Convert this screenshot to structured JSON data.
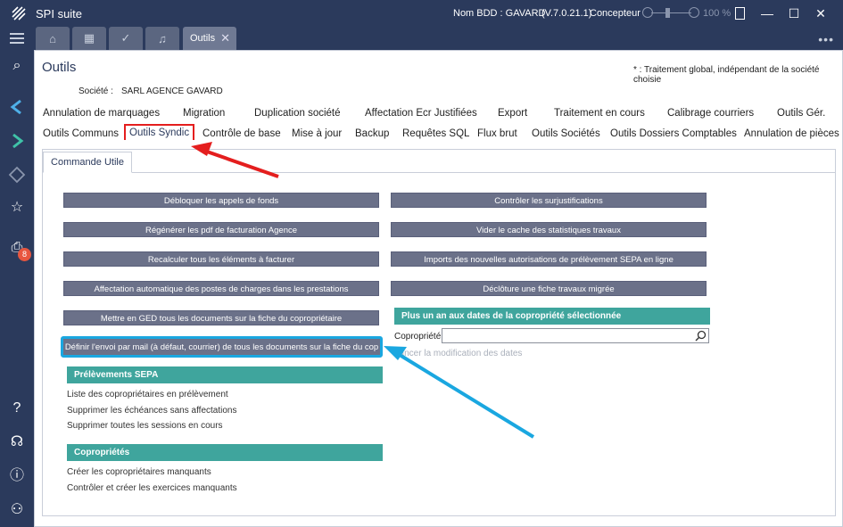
{
  "titlebar": {
    "app_title": "SPI suite",
    "db_label": "Nom BDD : GAVARD",
    "version": "(V.7.0.21.1)",
    "role": "Concepteur",
    "zoom": "100 %"
  },
  "tabs": {
    "active_label": "Outils"
  },
  "sidebar": {
    "badge_count": "8"
  },
  "page": {
    "title": "Outils",
    "note": "* : Traitement global, indépendant de la société choisie",
    "societe_label": "Société :",
    "societe_value": "SARL AGENCE GAVARD"
  },
  "main_tabs_row1": [
    "Annulation de marquages",
    "Migration",
    "Duplication société",
    "Affectation Ecr Justifiées",
    "Export",
    "Traitement en cours",
    "Calibrage courriers",
    "Outils Gér."
  ],
  "main_tabs_row2": [
    "Outils Communs",
    "Outils Syndic",
    "Contrôle de base",
    "Mise à jour",
    "Backup",
    "Requêtes SQL",
    "Flux brut",
    "Outils Sociétés",
    "Outils Dossiers Comptables",
    "Annulation de pièces"
  ],
  "inner_tab": "Commande Utile",
  "buttons_left": [
    "Débloquer les appels de fonds",
    "Régénérer les pdf de facturation Agence",
    "Recalculer tous les éléments à facturer",
    "Affectation automatique des postes de charges dans les prestations",
    "Mettre en GED tous les documents sur la fiche du copropriétaire",
    "Définir l'envoi par mail (à défaut, courrier) de tous les documents sur la fiche du cop"
  ],
  "buttons_right": [
    "Contrôler les surjustifications",
    "Vider le cache des statistiques travaux",
    "Imports des nouvelles autorisations de prélèvement SEPA en ligne",
    "Déclôture une fiche travaux migrée"
  ],
  "copro_section": {
    "header": "Plus un an aux dates de la copropriété sélectionnée",
    "field_label": "Copropriété",
    "hint": "Lancer la modification des dates"
  },
  "sepa_section": {
    "header": "Prélèvements SEPA",
    "links": [
      "Liste des copropriétaires en prélèvement",
      "Supprimer les échéances sans affectations",
      "Supprimer toutes les sessions en cours"
    ]
  },
  "coproprietes_section": {
    "header": "Copropriétés",
    "links": [
      "Créer les copropriétaires manquants",
      "Contrôler et créer les exercices manquants"
    ]
  },
  "colors": {
    "sidebar": "#2b3a5c",
    "button": "#6b7189",
    "section": "#3fa59d",
    "red_annotation": "#e41e1e",
    "blue_annotation": "#1aa7e0"
  }
}
